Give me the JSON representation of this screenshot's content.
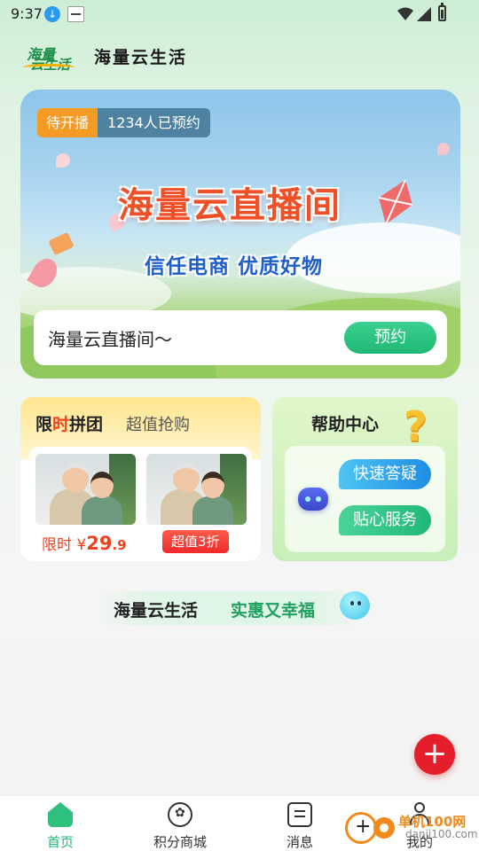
{
  "status_bar": {
    "time": "9:37",
    "icons": [
      "download-icon",
      "notification-icon",
      "wifi-icon",
      "signal-icon",
      "battery-icon"
    ]
  },
  "header": {
    "logo_line1": "海量",
    "logo_line2": "云生活",
    "brand_name": "海量云生活"
  },
  "live": {
    "status": "待开播",
    "reservations": "1234人已预约",
    "title": "海量云直播间",
    "slogan": "信任电商  优质好物",
    "room_name": "海量云直播间～",
    "reserve_label": "预约"
  },
  "group_buy": {
    "title_prefix": "限",
    "title_highlight": "时",
    "title_suffix": "拼团",
    "subtitle": "超值抢购",
    "price_label": "限时 ¥",
    "price_int": "29",
    "price_dec": ".9",
    "tag": "超值3折"
  },
  "help": {
    "title": "帮助中心",
    "question_mark": "?",
    "quick_answer": "快速答疑",
    "care_service": "贴心服务"
  },
  "slogan": {
    "name": "海量云生活",
    "tagline": "实惠又幸福"
  },
  "fab": {
    "label": "+"
  },
  "nav": {
    "items": [
      {
        "label": "首页",
        "icon": "home-icon",
        "active": true
      },
      {
        "label": "积分商城",
        "icon": "points-icon",
        "active": false
      },
      {
        "label": "消息",
        "icon": "message-icon",
        "active": false
      },
      {
        "label": "我的",
        "icon": "profile-icon",
        "active": false
      }
    ]
  },
  "watermark": {
    "text": "单机100网",
    "url": "danji100.com"
  },
  "colors": {
    "accent_green": "#1fb874",
    "accent_red": "#e41e2b",
    "title_orange": "#ef5028",
    "slogan_blue": "#1f5fc9"
  }
}
